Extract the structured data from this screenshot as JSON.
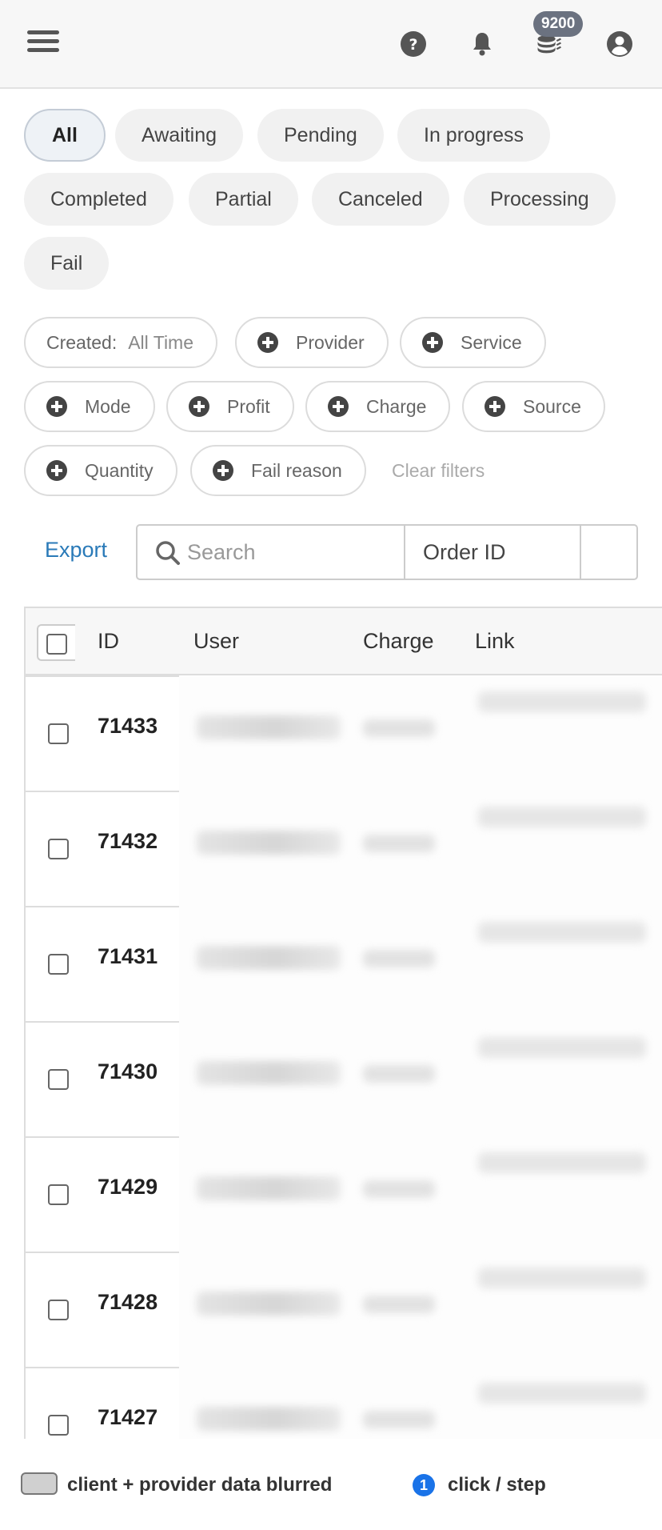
{
  "header": {
    "balance_badge": "9200",
    "icons": [
      "menu-icon",
      "help-icon",
      "bell-icon",
      "coins-icon",
      "user-icon"
    ]
  },
  "status_tabs": [
    {
      "label": "All",
      "active": true
    },
    {
      "label": "Awaiting",
      "active": false
    },
    {
      "label": "Pending",
      "active": false
    },
    {
      "label": "In progress",
      "active": false
    },
    {
      "label": "Completed",
      "active": false
    },
    {
      "label": "Partial",
      "active": false
    },
    {
      "label": "Canceled",
      "active": false
    },
    {
      "label": "Processing",
      "active": false
    },
    {
      "label": "Fail",
      "active": false
    }
  ],
  "filters": {
    "created_label": "Created:",
    "created_value": "All Time",
    "provider": "Provider",
    "service": "Service",
    "mode": "Mode",
    "profit": "Profit",
    "charge": "Charge",
    "source": "Source",
    "quantity": "Quantity",
    "fail_reason": "Fail reason",
    "clear": "Clear filters"
  },
  "toolbar": {
    "export_label": "Export",
    "search_placeholder": "Search",
    "search_field": "Order ID"
  },
  "table": {
    "columns": {
      "id": "ID",
      "user": "User",
      "charge": "Charge",
      "link": "Link"
    },
    "rows": [
      {
        "id": "71433"
      },
      {
        "id": "71432"
      },
      {
        "id": "71431"
      },
      {
        "id": "71430"
      },
      {
        "id": "71429"
      },
      {
        "id": "71428"
      },
      {
        "id": "71427"
      }
    ]
  },
  "legend": {
    "blurred_text": "client + provider data blurred",
    "step_number": "1",
    "step_text": "click / step"
  },
  "colors": {
    "accent": "#2a7ab8",
    "badge": "#6b7280",
    "step_marker": "#1a73e8"
  }
}
